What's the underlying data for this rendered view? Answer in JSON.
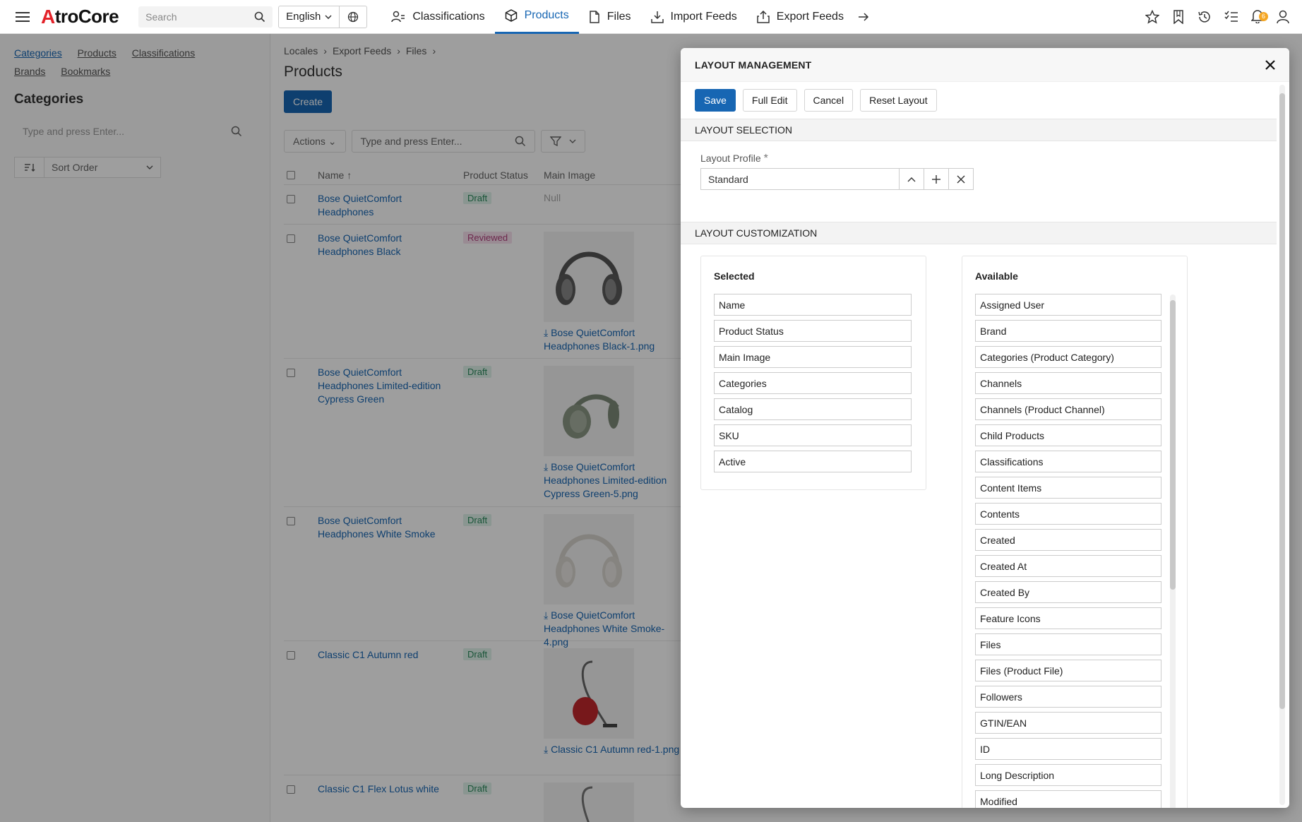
{
  "header": {
    "logo_a": "A",
    "logo_rest": "troCore",
    "search_placeholder": "Search",
    "language": "English",
    "nav": [
      {
        "label": "Classifications",
        "icon": "classifications-icon"
      },
      {
        "label": "Products",
        "icon": "box-icon",
        "active": true
      },
      {
        "label": "Files",
        "icon": "file-icon"
      },
      {
        "label": "Import Feeds",
        "icon": "import-icon"
      },
      {
        "label": "Export Feeds",
        "icon": "export-icon"
      }
    ],
    "notification_count": "6"
  },
  "sidebar": {
    "links": [
      "Categories",
      "Products",
      "Classifications",
      "Brands",
      "Bookmarks"
    ],
    "title": "Categories",
    "search_placeholder": "Type and press Enter...",
    "sort_label": "Sort Order"
  },
  "main": {
    "breadcrumbs": [
      "Locales",
      "Export Feeds",
      "Files"
    ],
    "title": "Products",
    "create_label": "Create",
    "actions_label": "Actions",
    "filter_placeholder": "Type and press Enter...",
    "columns": [
      "Name",
      "Product Status",
      "Main Image"
    ],
    "rows": [
      {
        "name": "Bose QuietComfort Headphones",
        "status": "Draft",
        "image": "Null",
        "file": ""
      },
      {
        "name": "Bose QuietComfort Headphones Black",
        "status": "Reviewed",
        "image": "headphones",
        "file": "Bose QuietComfort Headphones Black-1.png"
      },
      {
        "name": "Bose QuietComfort Headphones Limited-edition Cypress Green",
        "status": "Draft",
        "image": "headphones",
        "file": "Bose QuietComfort Headphones Limited-edition Cypress Green-5.png"
      },
      {
        "name": "Bose QuietComfort Headphones White Smoke",
        "status": "Draft",
        "image": "headphones",
        "file": "Bose QuietComfort Headphones White Smoke-4.png"
      },
      {
        "name": "Classic C1 Autumn red",
        "status": "Draft",
        "image": "vacuum",
        "file": "Classic C1 Autumn red-1.png"
      },
      {
        "name": "Classic C1 Flex Lotus white",
        "status": "Draft",
        "image": "vacuum",
        "file": ""
      }
    ]
  },
  "modal": {
    "title": "LAYOUT MANAGEMENT",
    "buttons": {
      "save": "Save",
      "full_edit": "Full Edit",
      "cancel": "Cancel",
      "reset": "Reset Layout"
    },
    "section_selection": "LAYOUT SELECTION",
    "profile_label": "Layout Profile",
    "profile_required": "*",
    "profile_value": "Standard",
    "section_customization": "LAYOUT CUSTOMIZATION",
    "selected_title": "Selected",
    "selected": [
      "Name",
      "Product Status",
      "Main Image",
      "Categories",
      "Catalog",
      "SKU",
      "Active"
    ],
    "available_title": "Available",
    "available": [
      "Assigned User",
      "Brand",
      "Categories (Product Category)",
      "Channels",
      "Channels (Product Channel)",
      "Child Products",
      "Classifications",
      "Content Items",
      "Contents",
      "Created",
      "Created At",
      "Created By",
      "Feature Icons",
      "Files",
      "Files (Product File)",
      "Followers",
      "GTIN/EAN",
      "ID",
      "Long Description",
      "Modified"
    ]
  },
  "colors": {
    "accent": "#1766b3",
    "brand_red": "#e3232a",
    "badge": "#f5a623"
  }
}
